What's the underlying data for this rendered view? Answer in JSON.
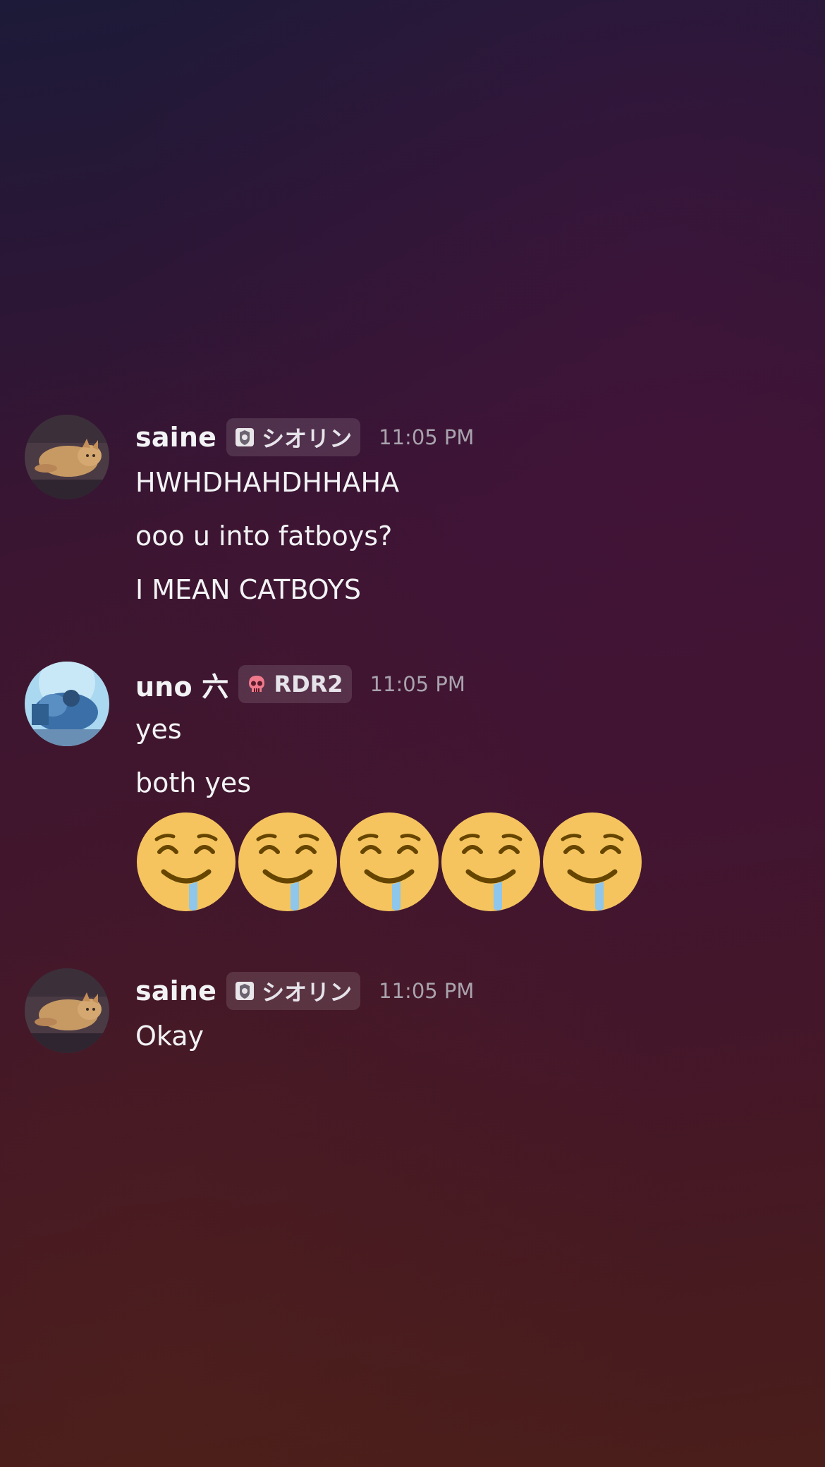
{
  "messages": [
    {
      "username": "saine",
      "tag": {
        "icon": "crest-icon",
        "text": "シオリン"
      },
      "timestamp": "11:05 PM",
      "avatar": "cat-avatar",
      "lines": [
        "HWHDHAHDHHAHA",
        "ooo u into fatboys?",
        "I MEAN CATBOYS"
      ]
    },
    {
      "username": "uno 六",
      "tag": {
        "icon": "skull-icon",
        "text": "RDR2"
      },
      "timestamp": "11:05 PM",
      "avatar": "character-avatar",
      "lines": [
        "yes",
        "both yes"
      ],
      "emojis": [
        "drooling-face-emoji",
        "drooling-face-emoji",
        "drooling-face-emoji",
        "drooling-face-emoji",
        "drooling-face-emoji"
      ]
    },
    {
      "username": "saine",
      "tag": {
        "icon": "crest-icon",
        "text": "シオリン"
      },
      "timestamp": "11:05 PM",
      "avatar": "cat-avatar",
      "lines": [
        "Okay"
      ]
    }
  ],
  "colors": {
    "text": "#f2f3f5",
    "timestamp": "#a9a3ad",
    "emoji_face": "#f5c45e",
    "skull": "#f07a8c"
  }
}
